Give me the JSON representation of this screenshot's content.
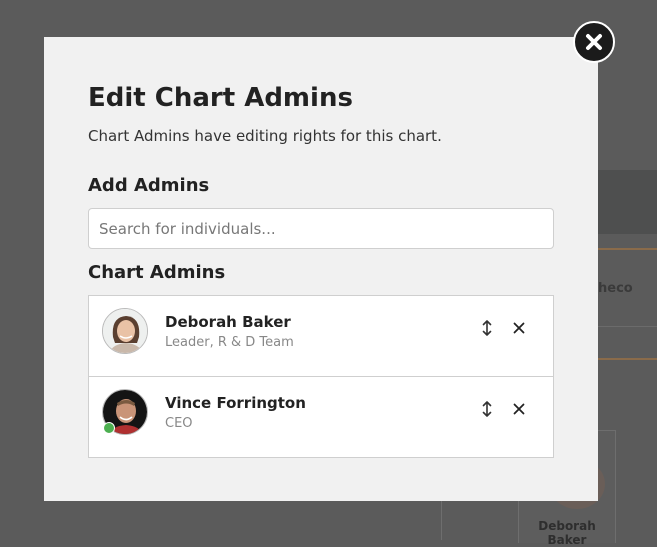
{
  "background": {
    "name_fragment": "heco",
    "card_name": "Deborah Baker"
  },
  "modal": {
    "title": "Edit Chart Admins",
    "subtitle": "Chart Admins have editing rights for this chart.",
    "add_heading": "Add Admins",
    "search_placeholder": "Search for individuals...",
    "list_heading": "Chart Admins",
    "admins": [
      {
        "name": "Deborah Baker",
        "role": "Leader, R & D Team",
        "online": false
      },
      {
        "name": "Vince Forrington",
        "role": "CEO",
        "online": true
      }
    ]
  },
  "icons": {
    "close": "close-icon",
    "reorder": "reorder-arrows-icon",
    "remove": "x-icon"
  },
  "colors": {
    "overlay": "#5b5b5b",
    "modal_bg": "#f1f1f1",
    "online_status": "#4caf50"
  }
}
